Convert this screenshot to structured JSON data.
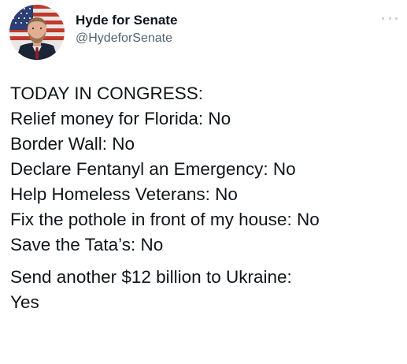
{
  "tweet": {
    "author": {
      "display_name": "Hyde for Senate",
      "handle": "@HydeforSenate",
      "avatar_icon": "profile-photo-with-flag"
    },
    "more_icon": "more-horizontal-icon",
    "lines": [
      "TODAY IN CONGRESS:",
      "Relief money for Florida: No",
      "Border Wall: No",
      "Declare Fentanyl an Emergency: No",
      "Help Homeless Veterans: No",
      "Fix the pothole in front of my house: No",
      "Save the Tata’s:  No"
    ],
    "final_lines": [
      "Send another $12 billion to Ukraine:",
      "Yes"
    ]
  },
  "colors": {
    "text": "#0f1419",
    "secondary_text": "#536471",
    "background": "#ffffff"
  }
}
